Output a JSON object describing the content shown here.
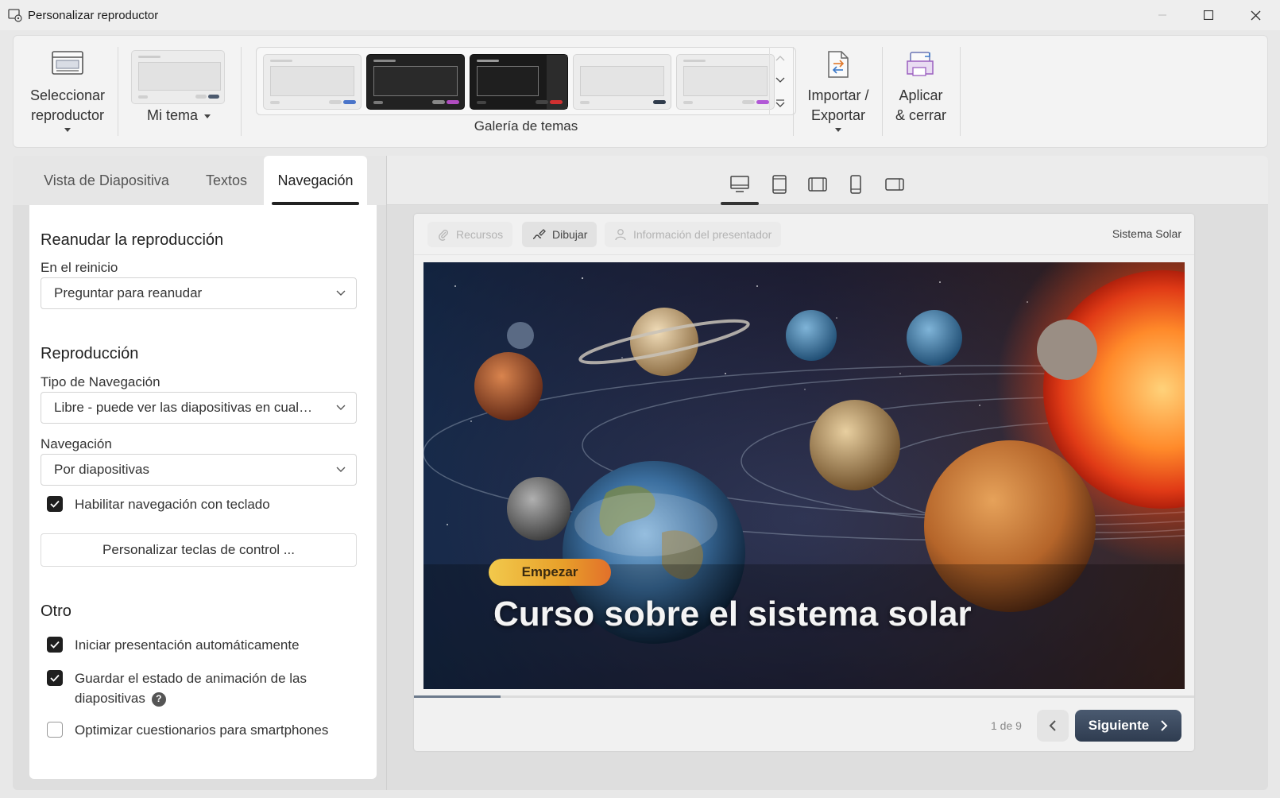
{
  "window": {
    "title": "Personalizar reproductor"
  },
  "ribbon": {
    "select_player": {
      "line1": "Seleccionar",
      "line2": "reproductor"
    },
    "my_theme": "Mi tema",
    "gallery_label": "Galería de temas",
    "import_export": {
      "line1": "Importar /",
      "line2": "Exportar"
    },
    "apply_close": {
      "line1": "Aplicar",
      "line2": "& cerrar"
    },
    "themes": [
      {
        "bg": "#ececec",
        "screen": "#e4e4e4",
        "accent": "#4a74c9",
        "style": "light"
      },
      {
        "bg": "#222222",
        "screen": "#2a2a2a",
        "accent": "#b04cc0",
        "style": "dark",
        "selected": true
      },
      {
        "bg": "#1a1a1a",
        "screen": "#222222",
        "accent": "#d13030",
        "style": "dark-split"
      },
      {
        "bg": "#ececec",
        "screen": "#e6e6e6",
        "accent": "#2f3b4b",
        "style": "light"
      },
      {
        "bg": "#ececec",
        "screen": "#e6e6e6",
        "accent": "#b158d6",
        "style": "light"
      }
    ]
  },
  "tabs": [
    {
      "label": "Vista de Diapositiva",
      "active": false
    },
    {
      "label": "Textos",
      "active": false
    },
    {
      "label": "Navegación",
      "active": true
    }
  ],
  "devices": [
    "desktop-icon",
    "tablet-portrait-icon",
    "tablet-landscape-icon",
    "phone-portrait-icon",
    "phone-landscape-icon"
  ],
  "panel": {
    "resume": {
      "heading": "Reanudar la reproducción",
      "restart_label": "En el reinicio",
      "restart_value": "Preguntar para reanudar"
    },
    "playback": {
      "heading": "Reproducción",
      "nav_type_label": "Tipo de Navegación",
      "nav_type_value": "Libre - puede ver las diapositivas en cualquier orden",
      "nav_label": "Navegación",
      "nav_value": "Por diapositivas",
      "keyboard_nav": "Habilitar navegación con teclado",
      "customize_keys": "Personalizar teclas de control ..."
    },
    "other": {
      "heading": "Otro",
      "autostart": "Iniciar presentación automáticamente",
      "save_state_line1": "Guardar el estado de animación de las",
      "save_state_line2": "diapositivas",
      "help": "?",
      "optimize": "Optimizar cuestionarios para smartphones"
    }
  },
  "player": {
    "resources": "Recursos",
    "draw": "Dibujar",
    "presenter_info": "Información del presentador",
    "course_title": "Sistema Solar",
    "slide_badge": "Empezar",
    "slide_title": "Curso sobre el sistema solar",
    "progress": 0.111,
    "counter": "1 de 9",
    "next": "Siguiente"
  },
  "colors": {
    "accent_dark": "#2f3c50",
    "badge_orange": "#e8a02a"
  }
}
